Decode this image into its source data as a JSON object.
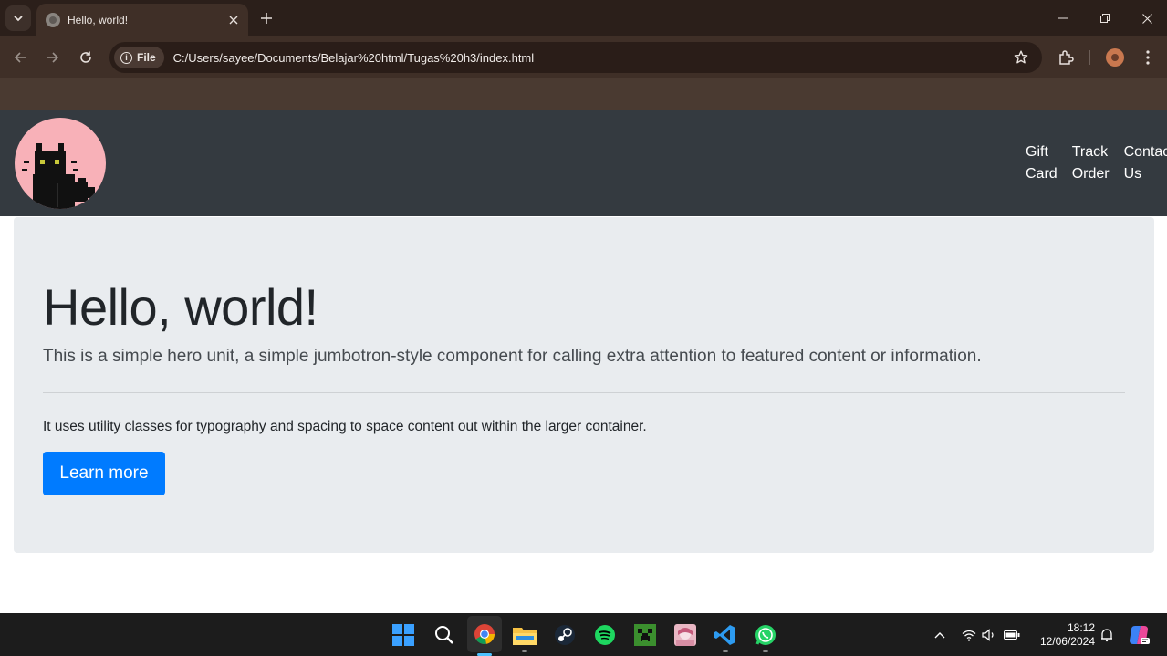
{
  "browser": {
    "tab_title": "Hello, world!",
    "site_chip_label": "File",
    "url": "C:/Users/sayee/Documents/Belajar%20html/Tugas%20h3/index.html"
  },
  "site": {
    "nav_links": [
      {
        "line1": "Gift",
        "line2": "Card"
      },
      {
        "line1": "Track",
        "line2": "Order"
      },
      {
        "line1": "Contac",
        "line2": "Us"
      }
    ],
    "hero": {
      "title": "Hello, world!",
      "lead": "This is a simple hero unit, a simple jumbotron-style component for calling extra attention to featured content or information.",
      "body": "It uses utility classes for typography and spacing to space content out within the larger container.",
      "button_label": "Learn more"
    },
    "colors": {
      "navbar": "#343a40",
      "jumbotron": "#e9ecef",
      "primary": "#007bff",
      "logo_bg": "#f8b1b8"
    }
  },
  "taskbar": {
    "apps": [
      "start-icon",
      "search-icon",
      "chrome-icon",
      "file-explorer-icon",
      "steam-icon",
      "spotify-icon",
      "minecraft-icon",
      "anime-app-icon",
      "vscode-icon",
      "whatsapp-icon"
    ],
    "time": "18:12",
    "date": "12/06/2024"
  }
}
